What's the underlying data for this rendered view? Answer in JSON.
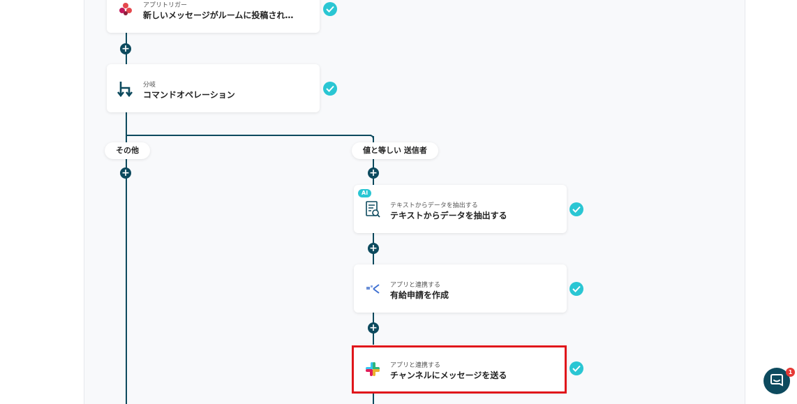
{
  "nodes": {
    "trigger": {
      "sub": "アプリトリガー",
      "title": "新しいメッセージがルームに投稿され…",
      "icon": "chatwork-icon"
    },
    "branch": {
      "sub": "分岐",
      "title": "コマンドオペレーション",
      "icon": "branch-icon"
    },
    "extract": {
      "badge": "AI",
      "sub": "テキストからデータを抽出する",
      "title": "テキストからデータを抽出する",
      "icon": "document-search-icon"
    },
    "leave": {
      "sub": "アプリと連携する",
      "title": "有給申請を作成",
      "icon": "workflow-app-icon"
    },
    "slack": {
      "sub": "アプリと連携する",
      "title": "チャンネルにメッセージを送る",
      "icon": "slack-icon"
    }
  },
  "branches": {
    "else_label": "その他",
    "match_label": "値と等しい 送信者"
  },
  "chat": {
    "unread": "1"
  },
  "colors": {
    "connector": "#0d4a5e",
    "check": "#2ac6d3",
    "highlight": "#e0161b"
  }
}
